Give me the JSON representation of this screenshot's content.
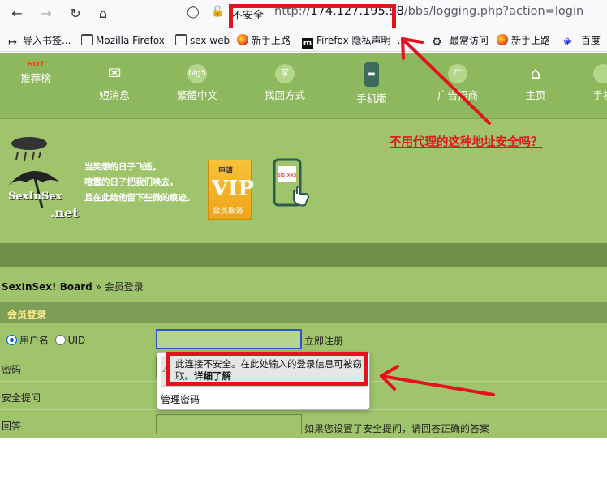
{
  "browser": {
    "url_security_label": "不安全",
    "url_host": "174.127.195.98",
    "url_prefix": "http://",
    "url_path": "/bbs/logging.php?action=login",
    "bookmarks": [
      "导入书签...",
      "Mozilla Firefox",
      "sex web",
      "新手上路",
      "Firefox 隐私声明 -...",
      "最常访问",
      "新手上路",
      "百度"
    ]
  },
  "topnav": {
    "hot_badge": "HOT",
    "items": [
      "推荐榜",
      "短消息",
      "繁體中文",
      "找回方式",
      "手机版",
      "广告招商",
      "主页",
      "手机"
    ],
    "icon_labels": [
      "big5",
      "家",
      "广"
    ]
  },
  "banner": {
    "logo_line1": "SexInSex",
    "logo_line2": ".net",
    "poem": [
      "当笑想的日子飞逝，",
      "喧嚣的日子把我们唤去，",
      "且在此给他留下些微的痕迹。"
    ],
    "vip_apply": "申请",
    "vip_big": "VIP",
    "vip_service": "会员服务",
    "phone_tag": "sis.xxx"
  },
  "annotation": {
    "question": "不用代理的这种地址安全吗？"
  },
  "breadcrumb": {
    "site": "SexInSex! Board",
    "separator": "»",
    "current": "会员登录"
  },
  "form": {
    "header": "会员登录",
    "radio_username": "用户名",
    "radio_uid": "UID",
    "register_link": "立即注册",
    "password_label": "密码",
    "security_question_label": "安全提问",
    "answer_label": "回答",
    "answer_hint": "如果您设置了安全提问，请回答正确的答案"
  },
  "popup": {
    "warning_text": "此连接不安全。在此处输入的登录信息可被窃取。",
    "learn_more": "详细了解",
    "manage_passwords": "管理密码"
  },
  "colors": {
    "annotation_red": "#e3121e",
    "page_green": "#9fc46c",
    "nav_green": "#8db85d"
  }
}
